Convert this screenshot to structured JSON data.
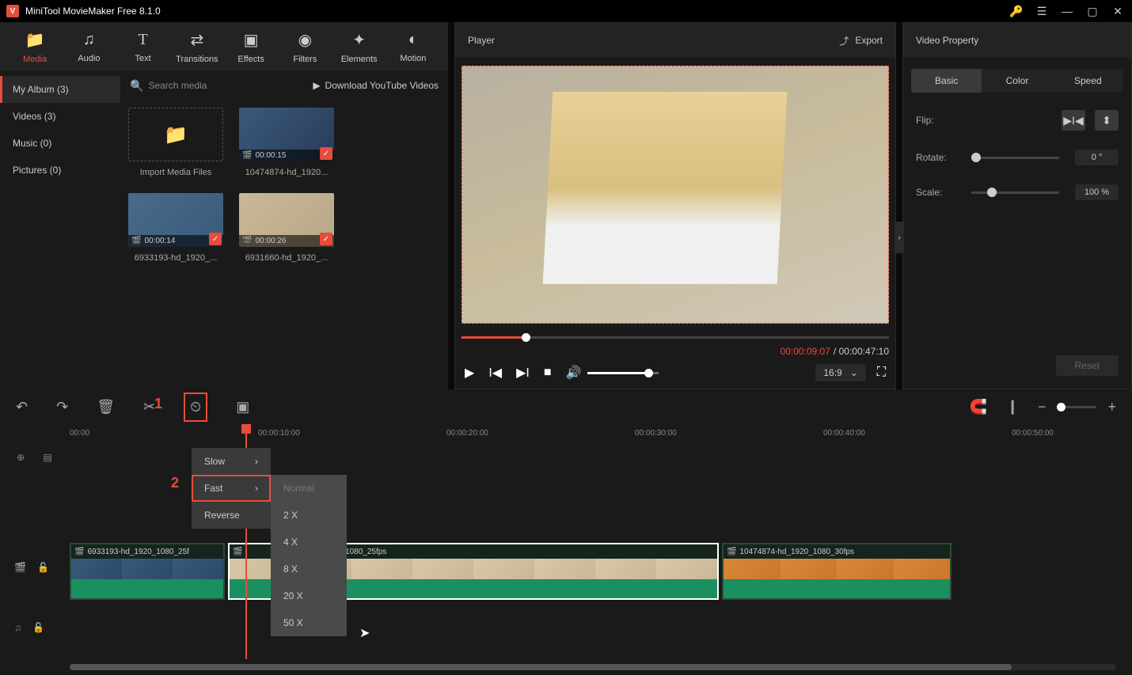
{
  "app": {
    "title": "MiniTool MovieMaker Free 8.1.0"
  },
  "tabs": [
    {
      "label": "Media",
      "icon": "📁"
    },
    {
      "label": "Audio",
      "icon": "♫"
    },
    {
      "label": "Text",
      "icon": "T"
    },
    {
      "label": "Transitions",
      "icon": "⇄"
    },
    {
      "label": "Effects",
      "icon": "▣"
    },
    {
      "label": "Filters",
      "icon": "◉"
    },
    {
      "label": "Elements",
      "icon": "✦"
    },
    {
      "label": "Motion",
      "icon": "●"
    }
  ],
  "sidebar": [
    {
      "label": "My Album (3)"
    },
    {
      "label": "Videos (3)"
    },
    {
      "label": "Music (0)"
    },
    {
      "label": "Pictures (0)"
    }
  ],
  "search": {
    "placeholder": "Search media"
  },
  "download_link": "Download YouTube Videos",
  "media": {
    "import_label": "Import Media Files",
    "items": [
      {
        "name": "10474874-hd_1920...",
        "duration": "00:00:15"
      },
      {
        "name": "6933193-hd_1920_...",
        "duration": "00:00:14"
      },
      {
        "name": "6931660-hd_1920_...",
        "duration": "00:00:26"
      }
    ]
  },
  "player": {
    "title": "Player",
    "export": "Export",
    "current": "00:00:09:07",
    "total": "00:00:47:10",
    "sep": " / ",
    "ratio": "16:9"
  },
  "props": {
    "title": "Video Property",
    "tabs": [
      "Basic",
      "Color",
      "Speed"
    ],
    "flip": "Flip:",
    "rotate": "Rotate:",
    "rotate_val": "0 °",
    "scale": "Scale:",
    "scale_val": "100 %",
    "reset": "Reset"
  },
  "speed_menu": {
    "items": [
      {
        "label": "Slow",
        "arrow": true
      },
      {
        "label": "Fast",
        "arrow": true,
        "highlight": true
      },
      {
        "label": "Reverse",
        "arrow": false
      }
    ],
    "sub": [
      "Normal",
      "2 X",
      "4 X",
      "8 X",
      "20 X",
      "50 X"
    ]
  },
  "annotations": {
    "n1": "1",
    "n2": "2"
  },
  "timeline": {
    "marks": [
      "00:00",
      "00:00:10:00",
      "00:00:20:00",
      "00:00:30:00",
      "00:00:40:00",
      "00:00:50:00"
    ],
    "clips": [
      {
        "label": "6933193-hd_1920_1080_25f"
      },
      {
        "label": "_1080_25fps"
      },
      {
        "label": "10474874-hd_1920_1080_30fps"
      }
    ]
  }
}
